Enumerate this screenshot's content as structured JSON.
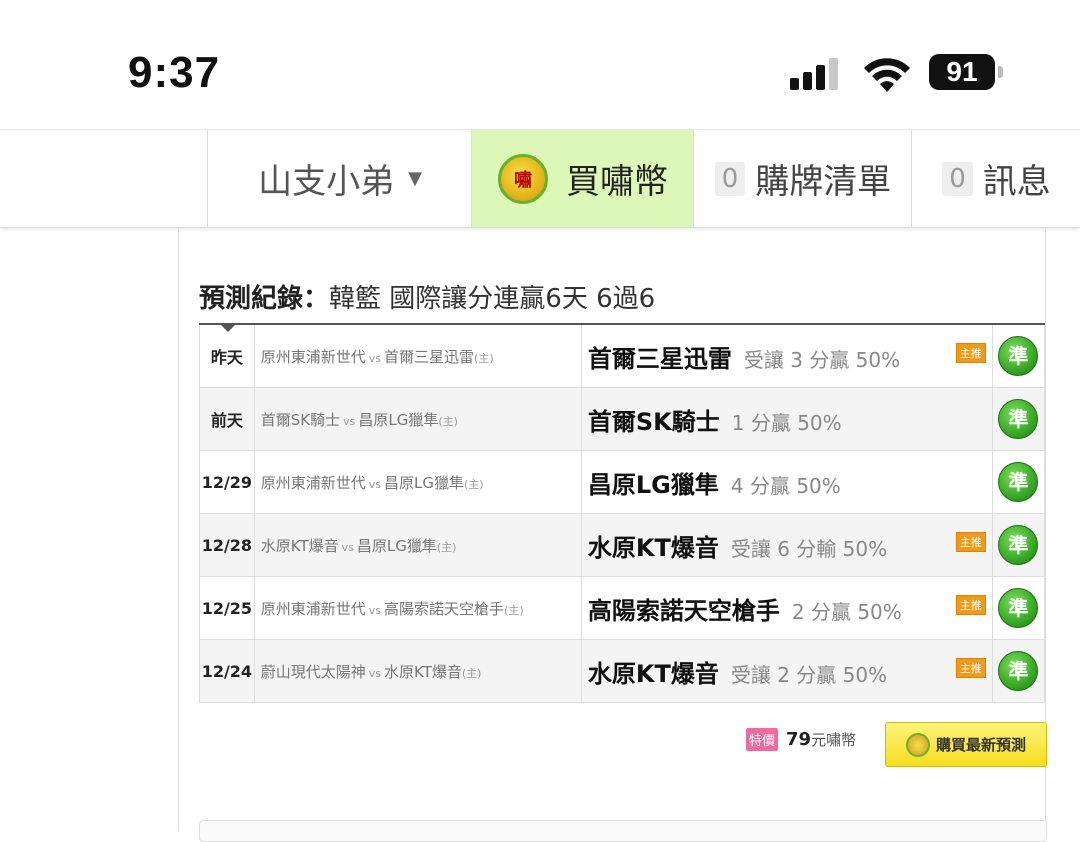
{
  "status_bar": {
    "time": "9:37",
    "battery": "91"
  },
  "nav": {
    "user": "山支小弟",
    "buy_label": "買嘯幣",
    "cart_count": "0",
    "cart_label": "購牌清單",
    "msg_count": "0",
    "msg_label": "訊息"
  },
  "record": {
    "label": "預測紀錄：",
    "detail": "韓籃 國際讓分連贏6天 6過6"
  },
  "rows": [
    {
      "date": "昨天",
      "away": "原州東浦新世代",
      "vs": "vs",
      "home": "首爾三星迅雷",
      "home_mark": "(主)",
      "pick_team": "首爾三星迅雷",
      "pick_detail": "受讓 3 分贏 50%",
      "tag": "主推",
      "result": "準"
    },
    {
      "date": "前天",
      "away": "首爾SK騎士",
      "vs": "vs",
      "home": "昌原LG獵隼",
      "home_mark": "(主)",
      "pick_team": "首爾SK騎士",
      "pick_detail": "1 分贏 50%",
      "tag": "",
      "result": "準"
    },
    {
      "date": "12/29",
      "away": "原州東浦新世代",
      "vs": "vs",
      "home": "昌原LG獵隼",
      "home_mark": "(主)",
      "pick_team": "昌原LG獵隼",
      "pick_detail": "4 分贏 50%",
      "tag": "",
      "result": "準"
    },
    {
      "date": "12/28",
      "away": "水原KT爆音",
      "vs": "vs",
      "home": "昌原LG獵隼",
      "home_mark": "(主)",
      "pick_team": "水原KT爆音",
      "pick_detail": "受讓 6 分輸 50%",
      "tag": "主推",
      "result": "準"
    },
    {
      "date": "12/25",
      "away": "原州東浦新世代",
      "vs": "vs",
      "home": "高陽索諾天空槍手",
      "home_mark": "(主)",
      "pick_team": "高陽索諾天空槍手",
      "pick_detail": "2 分贏 50%",
      "tag": "主推",
      "result": "準"
    },
    {
      "date": "12/24",
      "away": "蔚山現代太陽神",
      "vs": "vs",
      "home": "水原KT爆音",
      "home_mark": "(主)",
      "pick_team": "水原KT爆音",
      "pick_detail": "受讓 2 分贏 50%",
      "tag": "主推",
      "result": "準"
    }
  ],
  "promo": {
    "special": "特價",
    "price": "79",
    "unit": "元嘯幣",
    "buy_button": "購買最新預測"
  }
}
